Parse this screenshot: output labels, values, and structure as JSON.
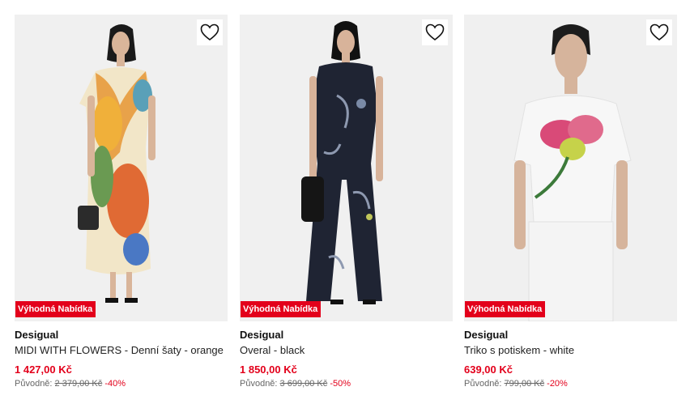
{
  "products": [
    {
      "brand": "Desigual",
      "name": "MIDI WITH FLOWERS - Denní šaty - orange",
      "price": "1 427,00 Kč",
      "original_label": "Původně:",
      "original_price": "2 379,00 Kč",
      "discount": "-40%",
      "badge": "Výhodná Nabídka",
      "image_alt": "model in floral midi dress"
    },
    {
      "brand": "Desigual",
      "name": "Overal - black",
      "price": "1 850,00 Kč",
      "original_label": "Původně:",
      "original_price": "3 699,00 Kč",
      "discount": "-50%",
      "badge": "Výhodná Nabídka",
      "image_alt": "model in black printed jumpsuit"
    },
    {
      "brand": "Desigual",
      "name": "Triko s potiskem - white",
      "price": "639,00 Kč",
      "original_label": "Původně:",
      "original_price": "799,00 Kč",
      "discount": "-20%",
      "badge": "Výhodná Nabídka",
      "image_alt": "model in white t-shirt with flower print"
    }
  ],
  "colors": {
    "accent": "#e3001b",
    "image_bg": "#f1f1f1"
  },
  "icons": {
    "wishlist": "heart-outline-icon"
  }
}
